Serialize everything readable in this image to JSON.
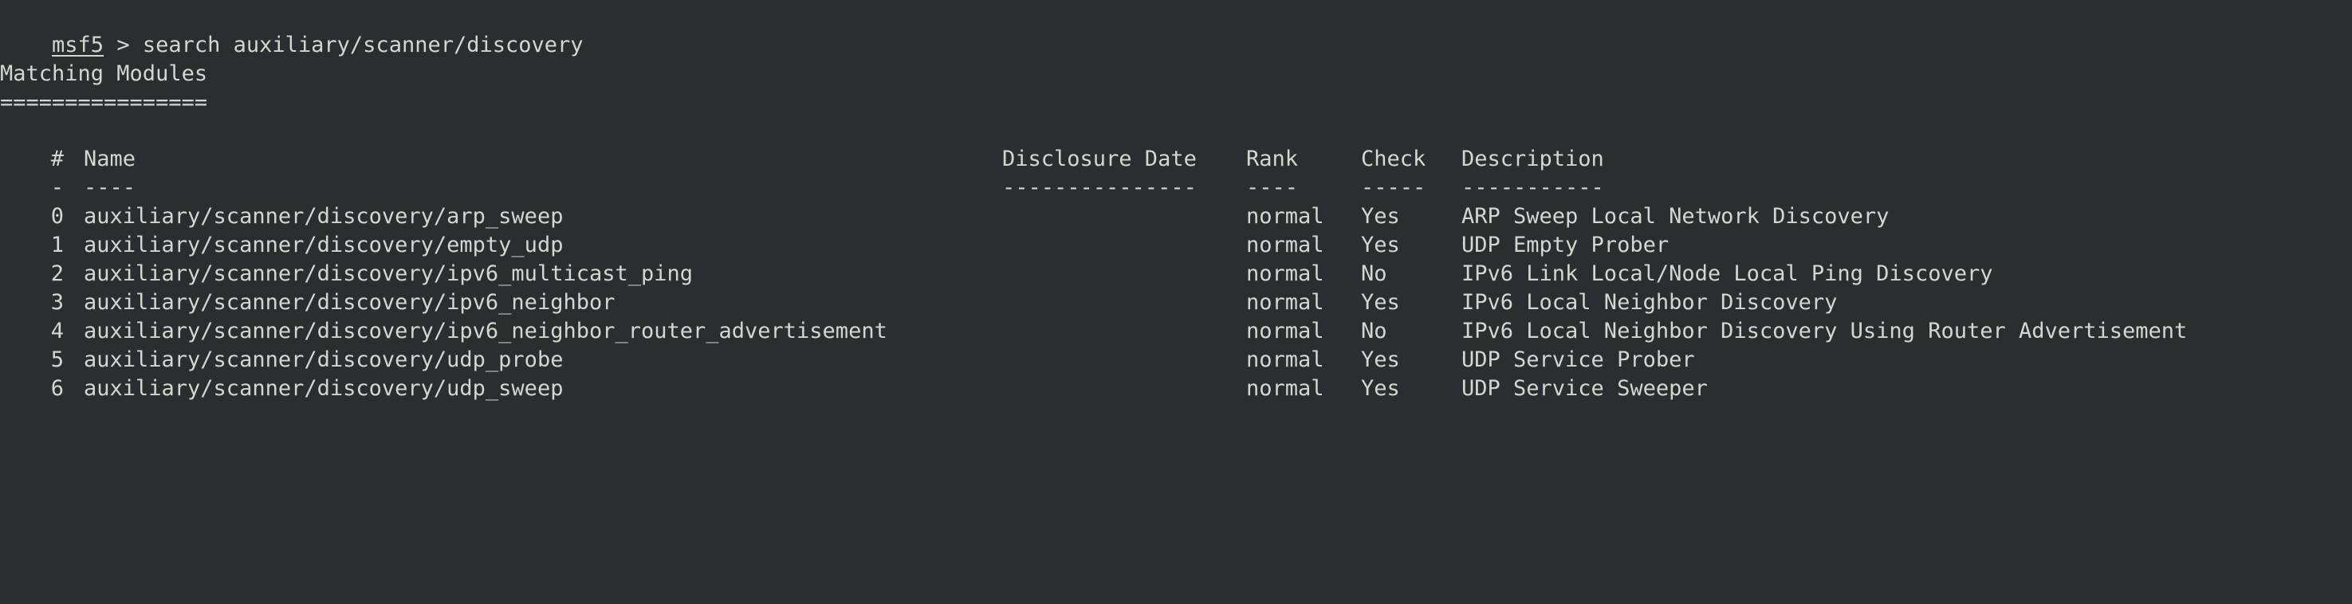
{
  "terminal": {
    "prompt": "msf5",
    "separator": " > ",
    "command": "search auxiliary/scanner/discovery",
    "section_title": "Matching Modules",
    "section_rule": "================"
  },
  "table": {
    "headers": {
      "num": "#",
      "name": "Name",
      "date": "Disclosure Date",
      "rank": "Rank",
      "check": "Check",
      "description": "Description"
    },
    "underlines": {
      "num": "-",
      "name": "----",
      "date": "---------------",
      "rank": "----",
      "check": "-----",
      "description": "-----------"
    },
    "rows": [
      {
        "num": "0",
        "name": "auxiliary/scanner/discovery/arp_sweep",
        "date": "",
        "rank": "normal",
        "check": "Yes",
        "description": "ARP Sweep Local Network Discovery"
      },
      {
        "num": "1",
        "name": "auxiliary/scanner/discovery/empty_udp",
        "date": "",
        "rank": "normal",
        "check": "Yes",
        "description": "UDP Empty Prober"
      },
      {
        "num": "2",
        "name": "auxiliary/scanner/discovery/ipv6_multicast_ping",
        "date": "",
        "rank": "normal",
        "check": "No",
        "description": "IPv6 Link Local/Node Local Ping Discovery"
      },
      {
        "num": "3",
        "name": "auxiliary/scanner/discovery/ipv6_neighbor",
        "date": "",
        "rank": "normal",
        "check": "Yes",
        "description": "IPv6 Local Neighbor Discovery"
      },
      {
        "num": "4",
        "name": "auxiliary/scanner/discovery/ipv6_neighbor_router_advertisement",
        "date": "",
        "rank": "normal",
        "check": "No",
        "description": "IPv6 Local Neighbor Discovery Using Router Advertisement"
      },
      {
        "num": "5",
        "name": "auxiliary/scanner/discovery/udp_probe",
        "date": "",
        "rank": "normal",
        "check": "Yes",
        "description": "UDP Service Prober"
      },
      {
        "num": "6",
        "name": "auxiliary/scanner/discovery/udp_sweep",
        "date": "",
        "rank": "normal",
        "check": "Yes",
        "description": "UDP Service Sweeper"
      }
    ]
  }
}
